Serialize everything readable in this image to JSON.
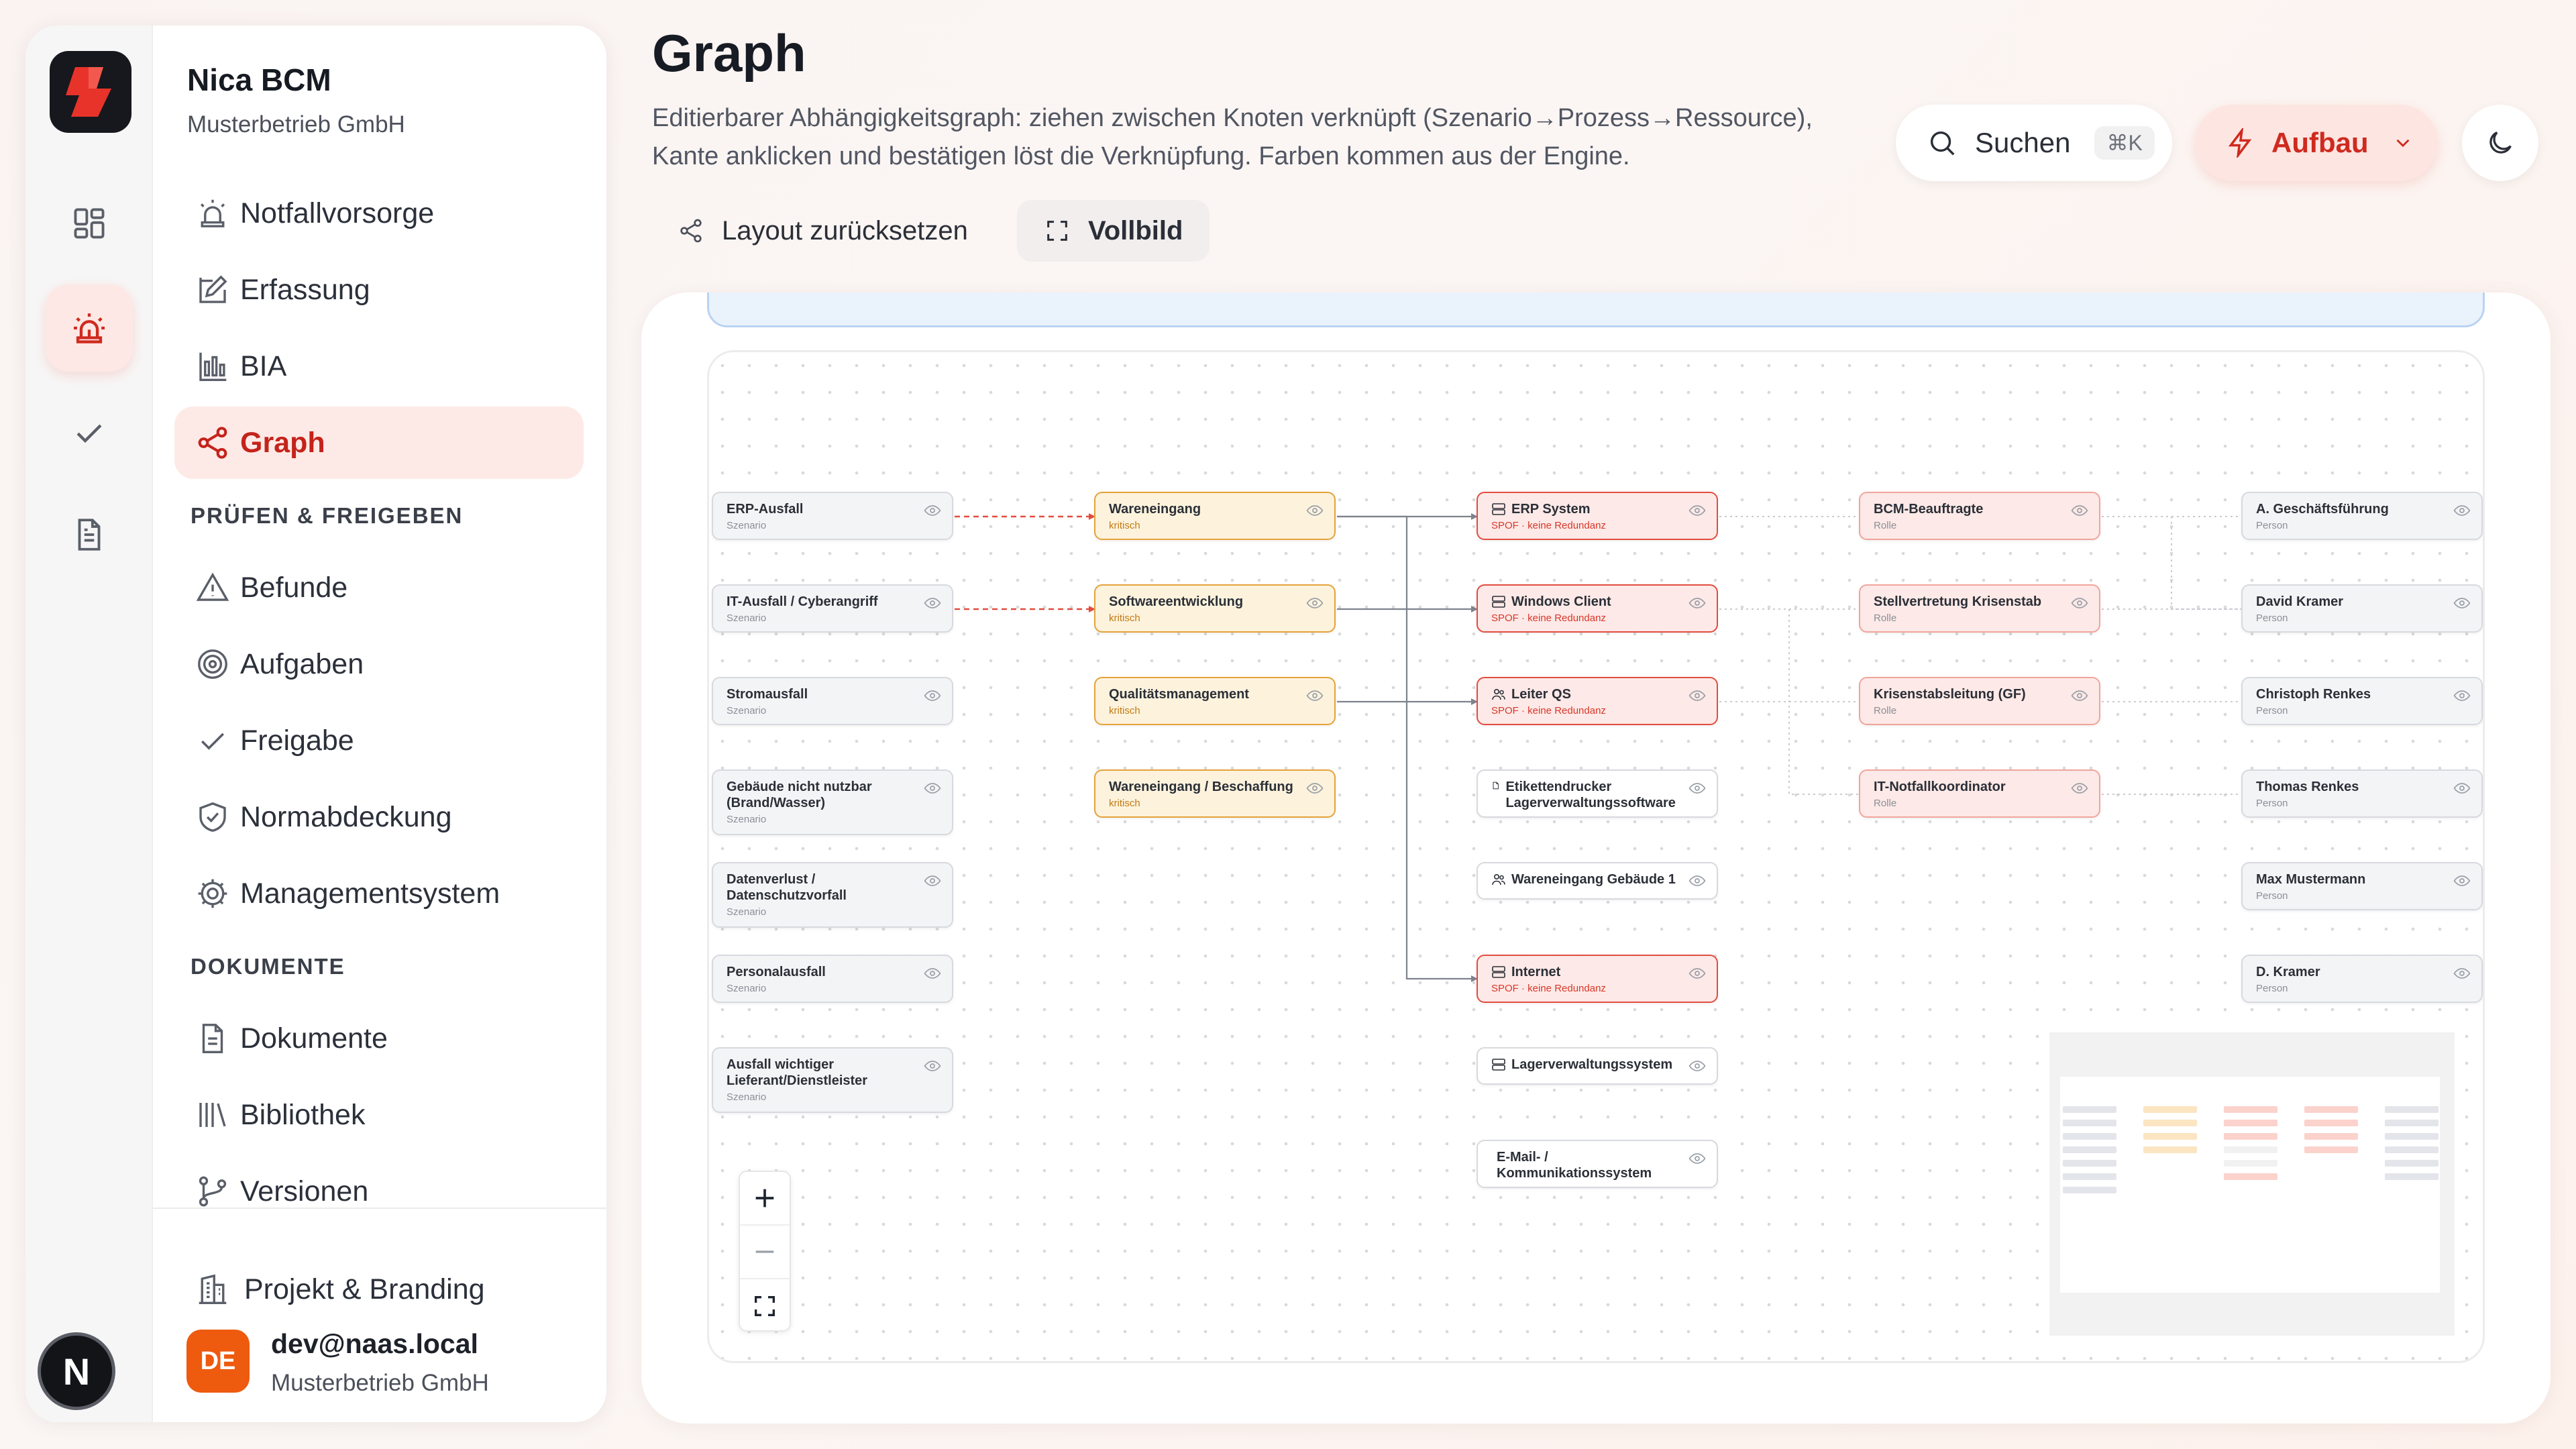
{
  "brand": {
    "name": "Nica BCM",
    "org": "Musterbetrieb GmbH"
  },
  "nav": {
    "items": [
      {
        "label": "Notfallvorsorge",
        "icon": "alarm-icon"
      },
      {
        "label": "Erfassung",
        "icon": "edit-icon"
      },
      {
        "label": "BIA",
        "icon": "bar-chart-icon"
      },
      {
        "label": "Graph",
        "icon": "share-graph-icon",
        "active": true
      }
    ],
    "section_review": "PRÜFEN & FREIGEBEN",
    "review_items": [
      {
        "label": "Befunde",
        "icon": "warning-icon"
      },
      {
        "label": "Aufgaben",
        "icon": "target-icon"
      },
      {
        "label": "Freigabe",
        "icon": "check-icon"
      },
      {
        "label": "Normabdeckung",
        "icon": "shield-check-icon"
      },
      {
        "label": "Managementsystem",
        "icon": "gear-icon"
      }
    ],
    "section_docs": "DOKUMENTE",
    "doc_items": [
      {
        "label": "Dokumente",
        "icon": "document-icon"
      },
      {
        "label": "Bibliothek",
        "icon": "library-icon"
      },
      {
        "label": "Versionen",
        "icon": "git-branch-icon"
      }
    ],
    "project": {
      "label": "Projekt & Branding",
      "icon": "building-icon"
    }
  },
  "user": {
    "initials": "DE",
    "email": "dev@naas.local",
    "org": "Musterbetrieb GmbH",
    "rail_avatar": "N"
  },
  "header": {
    "title": "Graph",
    "description": "Editierbarer Abhängigkeitsgraph: ziehen zwischen Knoten verknüpft (Szenario→Prozess→Ressource), Kante anklicken und bestätigen löst die Verknüpfung. Farben kommen aus der Engine.",
    "search_label": "Suchen",
    "search_shortcut": "⌘K",
    "mode_label": "Aufbau",
    "reset_label": "Layout zurücksetzen",
    "fullscreen_label": "Vollbild"
  },
  "colors": {
    "accent": "#cf2a1f",
    "process_border": "#e5a23a",
    "spof_border": "#e24d40",
    "role_border": "#f0a59c"
  },
  "graph": {
    "scenarios": [
      {
        "title": "ERP-Ausfall",
        "sub": "Szenario"
      },
      {
        "title": "IT-Ausfall / Cyberangriff",
        "sub": "Szenario"
      },
      {
        "title": "Stromausfall",
        "sub": "Szenario"
      },
      {
        "title": "Gebäude nicht nutzbar (Brand/Wasser)",
        "sub": "Szenario"
      },
      {
        "title": "Datenverlust / Datenschutzvorfall",
        "sub": "Szenario"
      },
      {
        "title": "Personalausfall",
        "sub": "Szenario"
      },
      {
        "title": "Ausfall wichtiger Lieferant/Dienstleister",
        "sub": "Szenario"
      }
    ],
    "processes": [
      {
        "title": "Wareneingang",
        "sub": "kritisch"
      },
      {
        "title": "Softwareentwicklung",
        "sub": "kritisch"
      },
      {
        "title": "Qualitätsmanagement",
        "sub": "kritisch"
      },
      {
        "title": "Wareneingang / Beschaffung",
        "sub": "kritisch"
      }
    ],
    "resources": [
      {
        "title": "ERP System",
        "sub": "SPOF · keine Redundanz",
        "spof": true,
        "icon": "server-icon"
      },
      {
        "title": "Windows Client",
        "sub": "SPOF · keine Redundanz",
        "spof": true,
        "icon": "server-icon"
      },
      {
        "title": "Leiter QS",
        "sub": "SPOF · keine Redundanz",
        "spof": true,
        "icon": "users-icon"
      },
      {
        "title": "Etikettendrucker Lagerverwaltungssoftware",
        "sub": "",
        "spof": false,
        "icon": "file-icon"
      },
      {
        "title": "Wareneingang Gebäude 1",
        "sub": "",
        "spof": false,
        "icon": "users-icon"
      },
      {
        "title": "Internet",
        "sub": "SPOF · keine Redundanz",
        "spof": true,
        "icon": "server-icon"
      },
      {
        "title": "Lagerverwaltungssystem",
        "sub": "",
        "spof": false,
        "icon": "server-icon"
      },
      {
        "title": "E-Mail- / Kommunikationssystem",
        "sub": "",
        "spof": false,
        "icon": "server-icon"
      }
    ],
    "roles": [
      {
        "title": "BCM-Beauftragte",
        "sub": "Rolle"
      },
      {
        "title": "Stellvertretung Krisenstab",
        "sub": "Rolle"
      },
      {
        "title": "Krisenstabsleitung (GF)",
        "sub": "Rolle"
      },
      {
        "title": "IT-Notfallkoordinator",
        "sub": "Rolle"
      }
    ],
    "persons": [
      {
        "title": "A. Geschäftsführung",
        "sub": "Person"
      },
      {
        "title": "David Kramer",
        "sub": "Person"
      },
      {
        "title": "Christoph Renkes",
        "sub": "Person"
      },
      {
        "title": "Thomas Renkes",
        "sub": "Person"
      },
      {
        "title": "Max Mustermann",
        "sub": "Person"
      },
      {
        "title": "D. Kramer",
        "sub": "Person"
      }
    ]
  }
}
